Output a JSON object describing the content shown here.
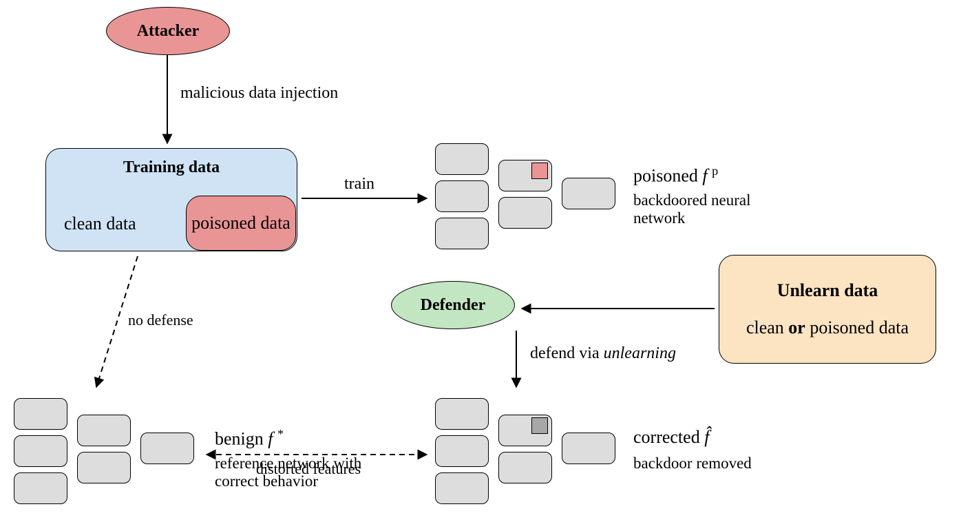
{
  "actors": {
    "attacker": {
      "label": "Attacker",
      "fill": "#e99595"
    },
    "defender": {
      "label": "Defender",
      "fill": "#c2e6c2"
    }
  },
  "training_data": {
    "title": "Training data",
    "clean_label": "clean data",
    "poisoned_label": "poisoned data",
    "fill": "#cfe3f5",
    "poison_fill": "#e99595"
  },
  "unlearn_data": {
    "title": "Unlearn data",
    "body_prefix": "clean ",
    "body_or": "or",
    "body_suffix": " poisoned data",
    "fill": "#fce3c2"
  },
  "flows": {
    "inject": "malicious data injection",
    "train": "train",
    "defense_html": "defend via <i>unlearning</i>",
    "nodefense": "no defense",
    "distort": "distorted features"
  },
  "nets": {
    "benign": {
      "title_html": "benign <i>f</i> <sup>*</sup>",
      "desc": "reference network with correct behavior"
    },
    "poisoned": {
      "title_html": "poisoned <i>f</i> <sup>p</sup>",
      "desc": "backdoored neural network",
      "patch_fill": "#e99595"
    },
    "corrected": {
      "title_html": "corrected <i>f̂</i>",
      "desc": "backdoor removed",
      "patch_fill": "#a7a7a7"
    }
  },
  "colors": {
    "grey_block": "#dddddd",
    "arrow": "#000000"
  }
}
